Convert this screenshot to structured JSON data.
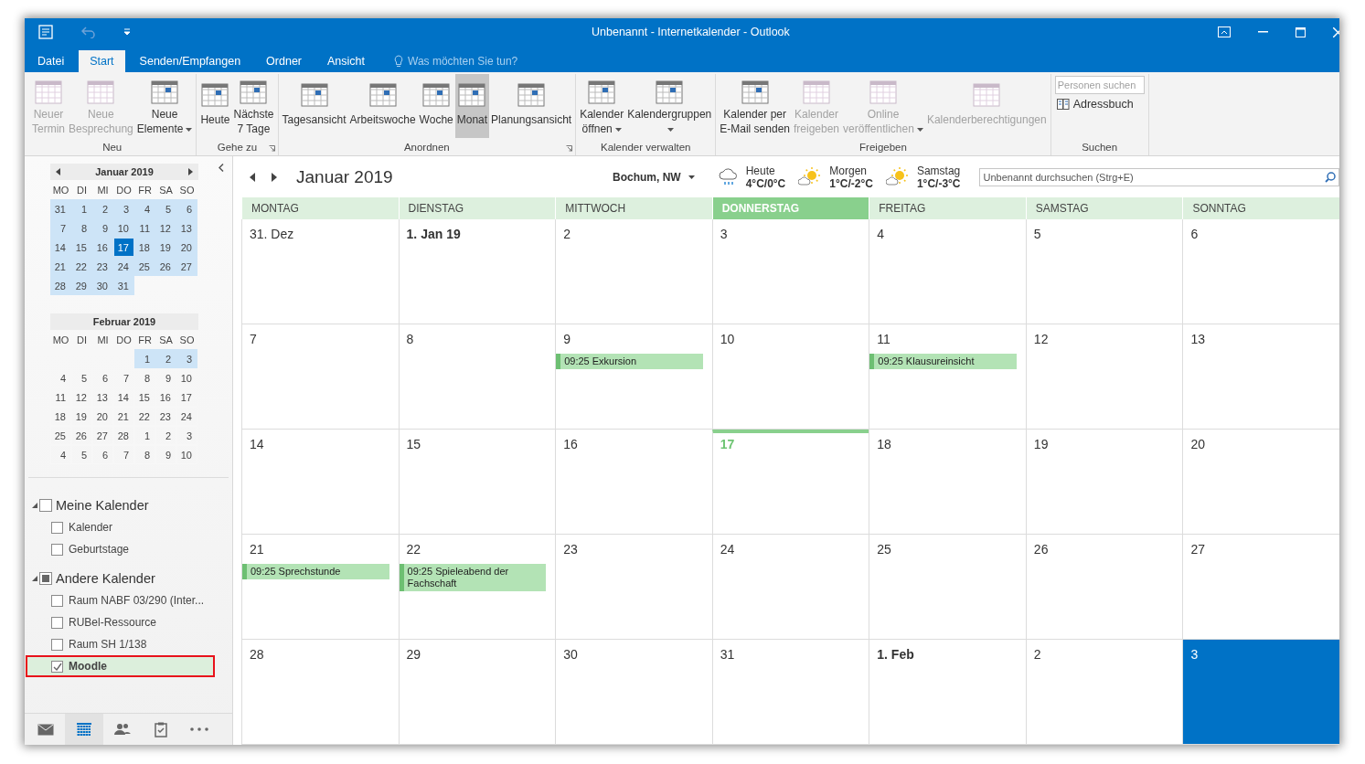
{
  "window": {
    "title": "Unbenannt - Internetkalender - Outlook"
  },
  "tabs": [
    {
      "label": "Datei",
      "selected": false
    },
    {
      "label": "Start",
      "selected": true
    },
    {
      "label": "Senden/Empfangen",
      "selected": false
    },
    {
      "label": "Ordner",
      "selected": false
    },
    {
      "label": "Ansicht",
      "selected": false
    }
  ],
  "tell_me": {
    "placeholder": "Was möchten Sie tun?"
  },
  "ribbon": {
    "groups": [
      {
        "label": "Neu",
        "items": [
          {
            "kind": "large",
            "lines": [
              "Neuer",
              "Termin"
            ],
            "disabled": true
          },
          {
            "kind": "large",
            "lines": [
              "Neue",
              "Besprechung"
            ],
            "disabled": true
          },
          {
            "kind": "large",
            "lines": [
              "Neue",
              "Elemente"
            ],
            "disabled": false,
            "dropdown": true
          }
        ]
      },
      {
        "label": "Gehe zu",
        "launcher": true,
        "items": [
          {
            "kind": "large",
            "lines": [
              "Heute"
            ],
            "disabled": false
          },
          {
            "kind": "large",
            "lines": [
              "Nächste",
              "7 Tage"
            ],
            "disabled": false
          }
        ]
      },
      {
        "label": "Anordnen",
        "launcher": true,
        "items": [
          {
            "kind": "large",
            "lines": [
              "Tagesansicht"
            ],
            "disabled": false,
            "selected": false
          },
          {
            "kind": "large",
            "lines": [
              "Arbeitswoche"
            ],
            "disabled": false,
            "selected": false
          },
          {
            "kind": "large",
            "lines": [
              "Woche"
            ],
            "disabled": false,
            "selected": false
          },
          {
            "kind": "large",
            "lines": [
              "Monat"
            ],
            "disabled": false,
            "selected": true
          },
          {
            "kind": "large",
            "lines": [
              "Planungsansicht"
            ],
            "disabled": false,
            "selected": false
          }
        ]
      },
      {
        "label": "Kalender verwalten",
        "items": [
          {
            "kind": "large",
            "lines": [
              "Kalender",
              "öffnen"
            ],
            "disabled": false,
            "dropdown": true
          },
          {
            "kind": "large",
            "lines": [
              "Kalendergruppen"
            ],
            "disabled": false,
            "dropdown": true
          }
        ]
      },
      {
        "label": "Freigeben",
        "items": [
          {
            "kind": "large",
            "lines": [
              "Kalender per",
              "E-Mail senden"
            ],
            "disabled": false
          },
          {
            "kind": "large",
            "lines": [
              "Kalender",
              "freigeben"
            ],
            "disabled": true
          },
          {
            "kind": "large",
            "lines": [
              "Online",
              "veröffentlichen"
            ],
            "disabled": true,
            "dropdown": true
          },
          {
            "kind": "large",
            "lines": [
              "Kalenderberechtigungen"
            ],
            "disabled": true
          }
        ]
      },
      {
        "label": "Suchen",
        "items": [
          {
            "kind": "search",
            "placeholder": "Personen suchen"
          },
          {
            "kind": "small",
            "lines": [
              "Adressbuch"
            ],
            "disabled": false
          }
        ]
      }
    ]
  },
  "mini_calendars": [
    {
      "title": "Januar 2019",
      "weekdays": [
        "MO",
        "DI",
        "MI",
        "DO",
        "FR",
        "SA",
        "SO"
      ],
      "weeks": [
        {
          "kind": "full",
          "days": [
            {
              "day": "31",
              "selected": true,
              "current": false
            },
            {
              "day": "1",
              "selected": true,
              "current": false
            },
            {
              "day": "2",
              "selected": true,
              "current": false
            },
            {
              "day": "3",
              "selected": true,
              "current": false
            },
            {
              "day": "4",
              "selected": true,
              "current": false
            },
            {
              "day": "5",
              "selected": true,
              "current": false
            },
            {
              "day": "6",
              "selected": true,
              "current": false
            }
          ]
        },
        {
          "kind": "full",
          "days": [
            {
              "day": "7",
              "selected": true,
              "current": false
            },
            {
              "day": "8",
              "selected": true,
              "current": false
            },
            {
              "day": "9",
              "selected": true,
              "current": false
            },
            {
              "day": "10",
              "selected": true,
              "current": false
            },
            {
              "day": "11",
              "selected": true,
              "current": false
            },
            {
              "day": "12",
              "selected": true,
              "current": false
            },
            {
              "day": "13",
              "selected": true,
              "current": false
            }
          ]
        },
        {
          "kind": "full",
          "days": [
            {
              "day": "14",
              "selected": true,
              "current": false
            },
            {
              "day": "15",
              "selected": true,
              "current": false
            },
            {
              "day": "16",
              "selected": true,
              "current": false
            },
            {
              "day": "17",
              "selected": true,
              "current": true
            },
            {
              "day": "18",
              "selected": true,
              "current": false
            },
            {
              "day": "19",
              "selected": true,
              "current": false
            },
            {
              "day": "20",
              "selected": true,
              "current": false
            }
          ]
        },
        {
          "kind": "full",
          "days": [
            {
              "day": "21",
              "selected": true,
              "current": false
            },
            {
              "day": "22",
              "selected": true,
              "current": false
            },
            {
              "day": "23",
              "selected": true,
              "current": false
            },
            {
              "day": "24",
              "selected": true,
              "current": false
            },
            {
              "day": "25",
              "selected": true,
              "current": false
            },
            {
              "day": "26",
              "selected": true,
              "current": false
            },
            {
              "day": "27",
              "selected": true,
              "current": false
            }
          ]
        },
        {
          "kind": "last",
          "days": [
            {
              "day": "28",
              "selected": true,
              "current": false
            },
            {
              "day": "29",
              "selected": true,
              "current": false
            },
            {
              "day": "30",
              "selected": true,
              "current": false
            },
            {
              "day": "31",
              "selected": true,
              "current": false
            }
          ]
        }
      ]
    },
    {
      "title": "Februar 2019",
      "weekdays": [
        "MO",
        "DI",
        "MI",
        "DO",
        "FR",
        "SA",
        "SO"
      ],
      "weeks": [
        {
          "kind": "first",
          "days": [
            {
              "day": "1",
              "selected": true,
              "current": false
            },
            {
              "day": "2",
              "selected": true,
              "current": false
            },
            {
              "day": "3",
              "selected": true,
              "current": false
            }
          ]
        },
        {
          "kind": "full",
          "days": [
            {
              "day": "4",
              "selected": false,
              "current": false
            },
            {
              "day": "5",
              "selected": false,
              "current": false
            },
            {
              "day": "6",
              "selected": false,
              "current": false
            },
            {
              "day": "7",
              "selected": false,
              "current": false
            },
            {
              "day": "8",
              "selected": false,
              "current": false
            },
            {
              "day": "9",
              "selected": false,
              "current": false
            },
            {
              "day": "10",
              "selected": false,
              "current": false
            }
          ]
        },
        {
          "kind": "full",
          "days": [
            {
              "day": "11",
              "selected": false,
              "current": false
            },
            {
              "day": "12",
              "selected": false,
              "current": false
            },
            {
              "day": "13",
              "selected": false,
              "current": false
            },
            {
              "day": "14",
              "selected": false,
              "current": false
            },
            {
              "day": "15",
              "selected": false,
              "current": false
            },
            {
              "day": "16",
              "selected": false,
              "current": false
            },
            {
              "day": "17",
              "selected": false,
              "current": false
            }
          ]
        },
        {
          "kind": "full",
          "days": [
            {
              "day": "18",
              "selected": false,
              "current": false
            },
            {
              "day": "19",
              "selected": false,
              "current": false
            },
            {
              "day": "20",
              "selected": false,
              "current": false
            },
            {
              "day": "21",
              "selected": false,
              "current": false
            },
            {
              "day": "22",
              "selected": false,
              "current": false
            },
            {
              "day": "23",
              "selected": false,
              "current": false
            },
            {
              "day": "24",
              "selected": false,
              "current": false
            }
          ]
        },
        {
          "kind": "full",
          "days": [
            {
              "day": "25",
              "selected": false,
              "current": false
            },
            {
              "day": "26",
              "selected": false,
              "current": false
            },
            {
              "day": "27",
              "selected": false,
              "current": false
            },
            {
              "day": "28",
              "selected": false,
              "current": false
            },
            {
              "day": "1",
              "selected": false,
              "current": false
            },
            {
              "day": "2",
              "selected": false,
              "current": false
            },
            {
              "day": "3",
              "selected": false,
              "current": false
            }
          ]
        },
        {
          "kind": "full",
          "days": [
            {
              "day": "4",
              "selected": false,
              "current": false
            },
            {
              "day": "5",
              "selected": false,
              "current": false
            },
            {
              "day": "6",
              "selected": false,
              "current": false
            },
            {
              "day": "7",
              "selected": false,
              "current": false
            },
            {
              "day": "8",
              "selected": false,
              "current": false
            },
            {
              "day": "9",
              "selected": false,
              "current": false
            },
            {
              "day": "10",
              "selected": false,
              "current": false
            }
          ]
        }
      ]
    }
  ],
  "folders": [
    {
      "label": "Meine Kalender",
      "expanded": true,
      "checked": false,
      "children": [
        {
          "label": "Kalender",
          "checked": false,
          "selected": false,
          "highlighted": false
        },
        {
          "label": "Geburtstage",
          "checked": false,
          "selected": false,
          "highlighted": false
        }
      ]
    },
    {
      "label": "Andere Kalender",
      "expanded": true,
      "mixed": true,
      "children": [
        {
          "label": "Raum NABF 03/290 (Inter...",
          "checked": false,
          "selected": false,
          "highlighted": false
        },
        {
          "label": "RUBel-Ressource",
          "checked": false,
          "selected": false,
          "highlighted": false
        },
        {
          "label": "Raum SH 1/138",
          "checked": false,
          "selected": false,
          "highlighted": false
        },
        {
          "label": "Moodle",
          "checked": true,
          "selected": true,
          "highlighted": true
        }
      ]
    }
  ],
  "nav": [
    {
      "kind": "mail",
      "selected": false
    },
    {
      "kind": "calendar",
      "selected": true
    },
    {
      "kind": "people",
      "selected": false
    },
    {
      "kind": "tasks",
      "selected": false
    },
    {
      "kind": "more",
      "selected": false
    }
  ],
  "calendar": {
    "title": "Januar 2019",
    "location": "Bochum, NW",
    "weather": [
      {
        "kind": "rain",
        "day": "Heute",
        "temp": "4°C/0°C"
      },
      {
        "kind": "sun",
        "day": "Morgen",
        "temp": "1°C/-2°C"
      },
      {
        "kind": "sun",
        "day": "Samstag",
        "temp": "1°C/-3°C"
      }
    ],
    "search": {
      "placeholder": "Unbenannt durchsuchen (Strg+E)"
    },
    "columns": [
      {
        "label": "MONTAG",
        "selected": false
      },
      {
        "label": "DIENSTAG",
        "selected": false
      },
      {
        "label": "MITTWOCH",
        "selected": false
      },
      {
        "label": "DONNERSTAG",
        "selected": true
      },
      {
        "label": "FREITAG",
        "selected": false
      },
      {
        "label": "SAMSTAG",
        "selected": false
      },
      {
        "label": "SONNTAG",
        "selected": false
      }
    ],
    "weeks": [
      [
        {
          "label": "31. Dez",
          "bold": false,
          "today": false,
          "selected": false
        },
        {
          "label": "1. Jan 19",
          "bold": true,
          "today": false,
          "selected": false
        },
        {
          "label": "2",
          "bold": false,
          "today": false,
          "selected": false
        },
        {
          "label": "3",
          "bold": false,
          "today": false,
          "selected": false
        },
        {
          "label": "4",
          "bold": false,
          "today": false,
          "selected": false
        },
        {
          "label": "5",
          "bold": false,
          "today": false,
          "selected": false
        },
        {
          "label": "6",
          "bold": false,
          "today": false,
          "selected": false
        }
      ],
      [
        {
          "label": "7",
          "bold": false,
          "today": false,
          "selected": false
        },
        {
          "label": "8",
          "bold": false,
          "today": false,
          "selected": false
        },
        {
          "label": "9",
          "bold": false,
          "today": false,
          "selected": false,
          "events": [
            "09:25 Exkursion"
          ]
        },
        {
          "label": "10",
          "bold": false,
          "today": false,
          "selected": false
        },
        {
          "label": "11",
          "bold": false,
          "today": false,
          "selected": false,
          "events": [
            "09:25 Klausureinsicht"
          ]
        },
        {
          "label": "12",
          "bold": false,
          "today": false,
          "selected": false
        },
        {
          "label": "13",
          "bold": false,
          "today": false,
          "selected": false
        }
      ],
      [
        {
          "label": "14",
          "bold": false,
          "today": false,
          "selected": false
        },
        {
          "label": "15",
          "bold": false,
          "today": false,
          "selected": false
        },
        {
          "label": "16",
          "bold": false,
          "today": false,
          "selected": false
        },
        {
          "label": "17",
          "bold": false,
          "today": true,
          "selected": false
        },
        {
          "label": "18",
          "bold": false,
          "today": false,
          "selected": false
        },
        {
          "label": "19",
          "bold": false,
          "today": false,
          "selected": false
        },
        {
          "label": "20",
          "bold": false,
          "today": false,
          "selected": false
        }
      ],
      [
        {
          "label": "21",
          "bold": false,
          "today": false,
          "selected": false,
          "events": [
            "09:25 Sprechstunde"
          ]
        },
        {
          "label": "22",
          "bold": false,
          "today": false,
          "selected": false,
          "events": [
            "09:25 Spieleabend der Fachschaft"
          ]
        },
        {
          "label": "23",
          "bold": false,
          "today": false,
          "selected": false
        },
        {
          "label": "24",
          "bold": false,
          "today": false,
          "selected": false
        },
        {
          "label": "25",
          "bold": false,
          "today": false,
          "selected": false
        },
        {
          "label": "26",
          "bold": false,
          "today": false,
          "selected": false
        },
        {
          "label": "27",
          "bold": false,
          "today": false,
          "selected": false
        }
      ],
      [
        {
          "label": "28",
          "bold": false,
          "today": false,
          "selected": false
        },
        {
          "label": "29",
          "bold": false,
          "today": false,
          "selected": false
        },
        {
          "label": "30",
          "bold": false,
          "today": false,
          "selected": false
        },
        {
          "label": "31",
          "bold": false,
          "today": false,
          "selected": false
        },
        {
          "label": "1. Feb",
          "bold": true,
          "today": false,
          "selected": false
        },
        {
          "label": "2",
          "bold": false,
          "today": false,
          "selected": false
        },
        {
          "label": "3",
          "bold": false,
          "today": false,
          "selected": true
        }
      ]
    ]
  }
}
